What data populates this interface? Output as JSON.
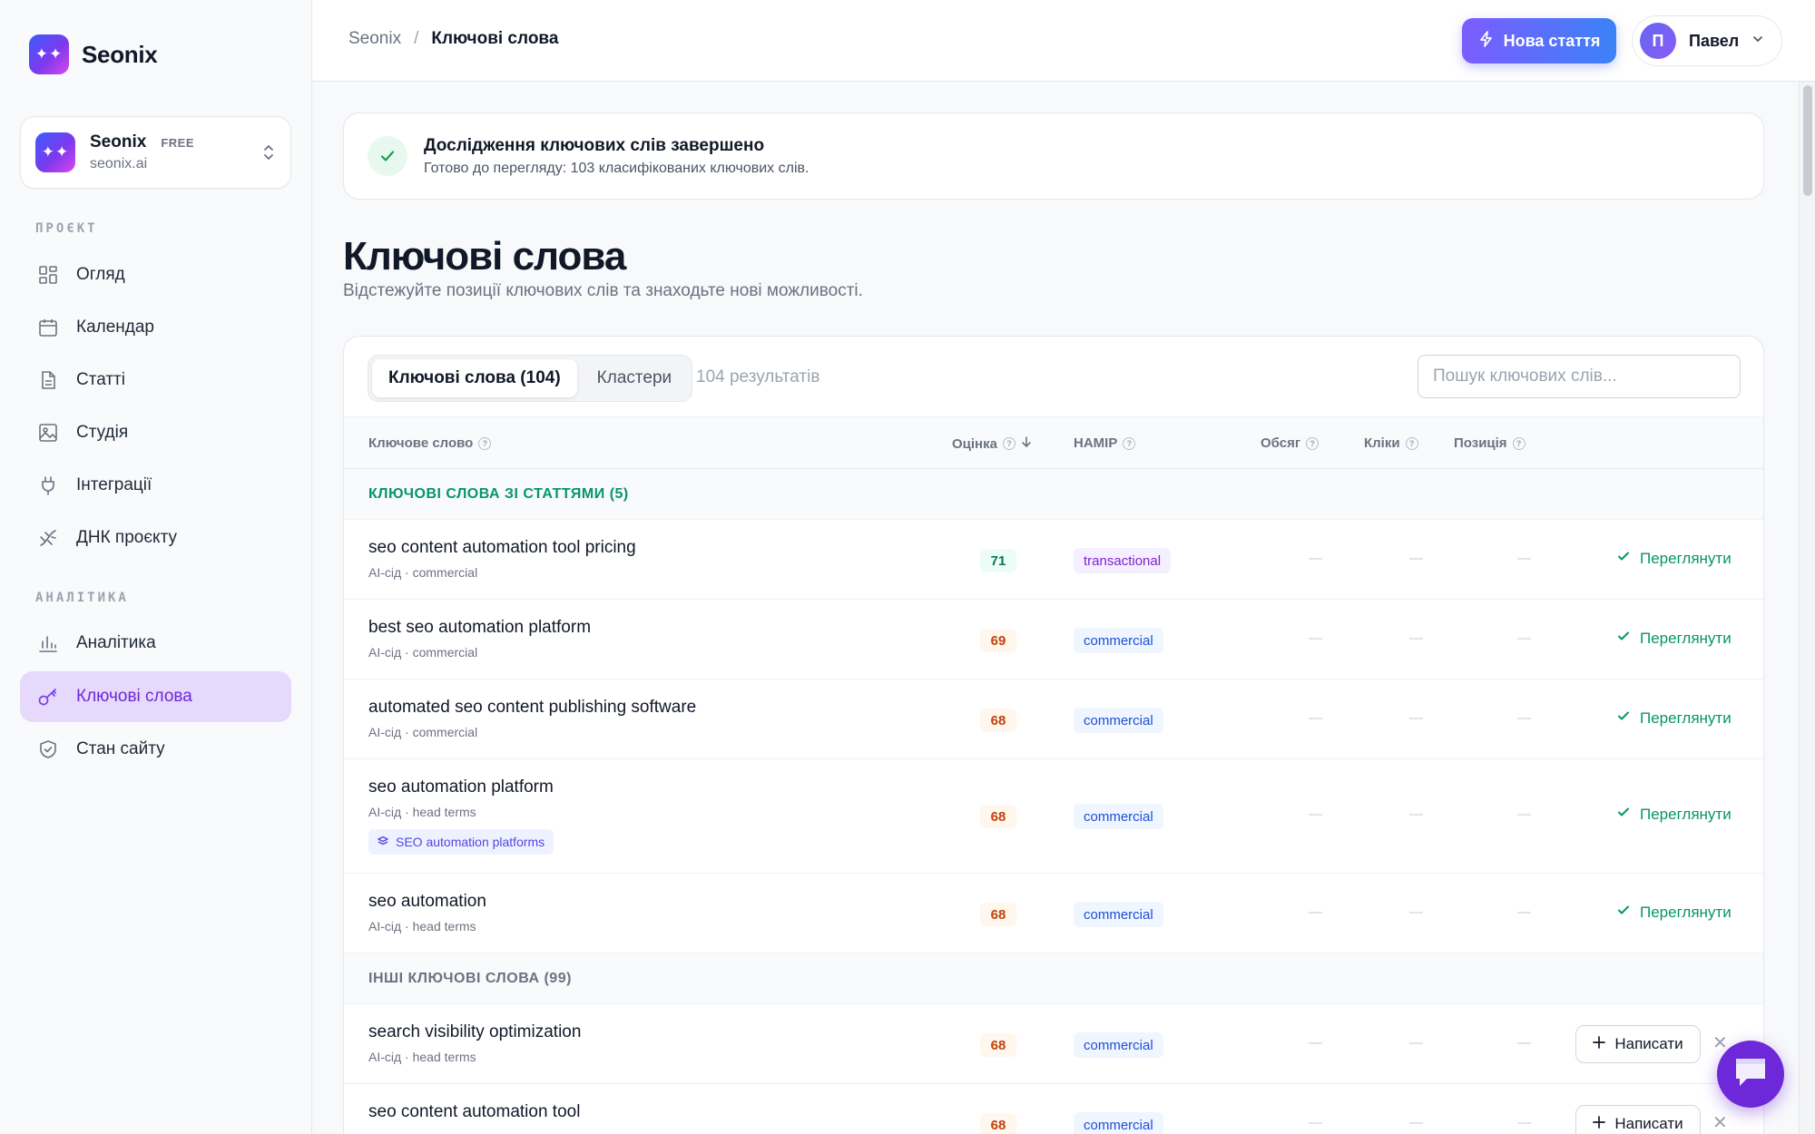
{
  "app": {
    "name": "Seonix"
  },
  "sidebar": {
    "project": {
      "name": "Seonix",
      "plan": "FREE",
      "domain": "seonix.ai"
    },
    "sections": [
      {
        "label": "ПРОЄКТ"
      },
      {
        "label": "АНАЛІТИКА"
      }
    ],
    "items": [
      {
        "label": "Огляд",
        "icon": "grid-icon"
      },
      {
        "label": "Календар",
        "icon": "calendar-icon"
      },
      {
        "label": "Статті",
        "icon": "document-icon"
      },
      {
        "label": "Студія",
        "icon": "image-icon"
      },
      {
        "label": "Інтеграції",
        "icon": "plug-icon"
      },
      {
        "label": "ДНК проєкту",
        "icon": "dna-icon"
      },
      {
        "label": "Аналітика",
        "icon": "bar-chart-icon"
      },
      {
        "label": "Ключові слова",
        "icon": "key-icon",
        "active": true
      },
      {
        "label": "Стан сайту",
        "icon": "shield-icon"
      }
    ]
  },
  "header": {
    "breadcrumb_root": "Seonix",
    "breadcrumb_sep": "/",
    "breadcrumb_current": "Ключові слова",
    "new_article": "Нова стаття",
    "user": {
      "initial": "П",
      "name": "Павел"
    }
  },
  "notice": {
    "title": "Дослідження ключових слів завершено",
    "subtitle": "Готово до перегляду: 103 класифікованих ключових слів."
  },
  "page": {
    "title": "Ключові слова",
    "subtitle": "Відстежуйте позиції ключових слів та знаходьте нові можливості."
  },
  "tabs": [
    {
      "label": "Ключові слова (104)",
      "active": true
    },
    {
      "label": "Кластери",
      "active": false
    }
  ],
  "results_count": "104 результатів",
  "search": {
    "placeholder": "Пошук ключових слів..."
  },
  "table": {
    "headers": {
      "keyword": "Ключове слово",
      "score": "Оцінка",
      "intent": "НАМІР",
      "volume": "Обсяг",
      "clicks": "Кліки",
      "position": "Позиція"
    },
    "dash": "—",
    "view_label": "Переглянути",
    "write_label": "Написати",
    "groups": [
      {
        "label": "КЛЮЧОВІ СЛОВА ЗІ СТАТТЯМИ (5)"
      },
      {
        "label": "ІНШІ КЛЮЧОВІ СЛОВА (99)"
      }
    ],
    "rows": [
      {
        "keyword": "seo content automation tool pricing",
        "meta": "AI-сід · commercial",
        "score": "71",
        "intent": "transactional"
      },
      {
        "keyword": "best seo automation platform",
        "meta": "AI-сід · commercial",
        "score": "69",
        "intent": "commercial"
      },
      {
        "keyword": "automated seo content publishing software",
        "meta": "AI-сід · commercial",
        "score": "68",
        "intent": "commercial"
      },
      {
        "keyword": "seo automation platform",
        "meta": "AI-сід · head terms",
        "score": "68",
        "intent": "commercial",
        "cluster": "SEO automation platforms"
      },
      {
        "keyword": "seo automation",
        "meta": "AI-сід · head terms",
        "score": "68",
        "intent": "commercial"
      },
      {
        "keyword": "search visibility optimization",
        "meta": "AI-сід · head terms",
        "score": "68",
        "intent": "commercial"
      },
      {
        "keyword": "seo content automation tool",
        "meta": "",
        "score": "68",
        "intent": "commercial"
      }
    ]
  },
  "colors": {
    "accent": "#7c3aed",
    "success": "#059669",
    "primary_gradient_start": "#7c5cff",
    "primary_gradient_end": "#3b82f6"
  }
}
